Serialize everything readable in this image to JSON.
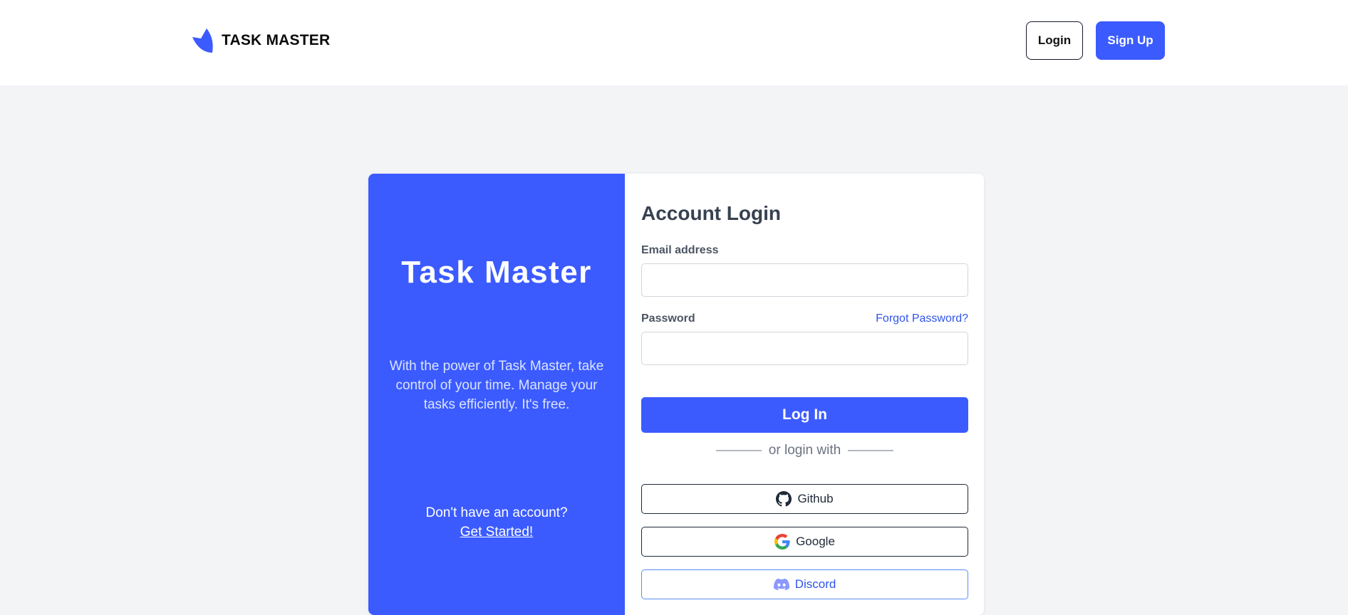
{
  "header": {
    "brand": "TASK MASTER",
    "login_label": "Login",
    "signup_label": "Sign Up"
  },
  "promo": {
    "title": "Task Master",
    "text": "With the power of Task Master, take control of your time. Manage your tasks efficiently. It's free.",
    "cta_text": "Don't have an account?",
    "cta_link": "Get Started!"
  },
  "form": {
    "title": "Account Login",
    "email_label": "Email address",
    "email_value": "",
    "password_label": "Password",
    "password_value": "",
    "forgot_label": "Forgot Password?",
    "submit_label": "Log In",
    "divider_text": "or login with",
    "social": [
      {
        "label": "Github",
        "icon": "github-icon"
      },
      {
        "label": "Google",
        "icon": "google-icon"
      },
      {
        "label": "Discord",
        "icon": "discord-icon"
      }
    ]
  },
  "colors": {
    "brand": "#3b5bff",
    "background": "#f3f4f6",
    "link": "#2f54eb"
  }
}
